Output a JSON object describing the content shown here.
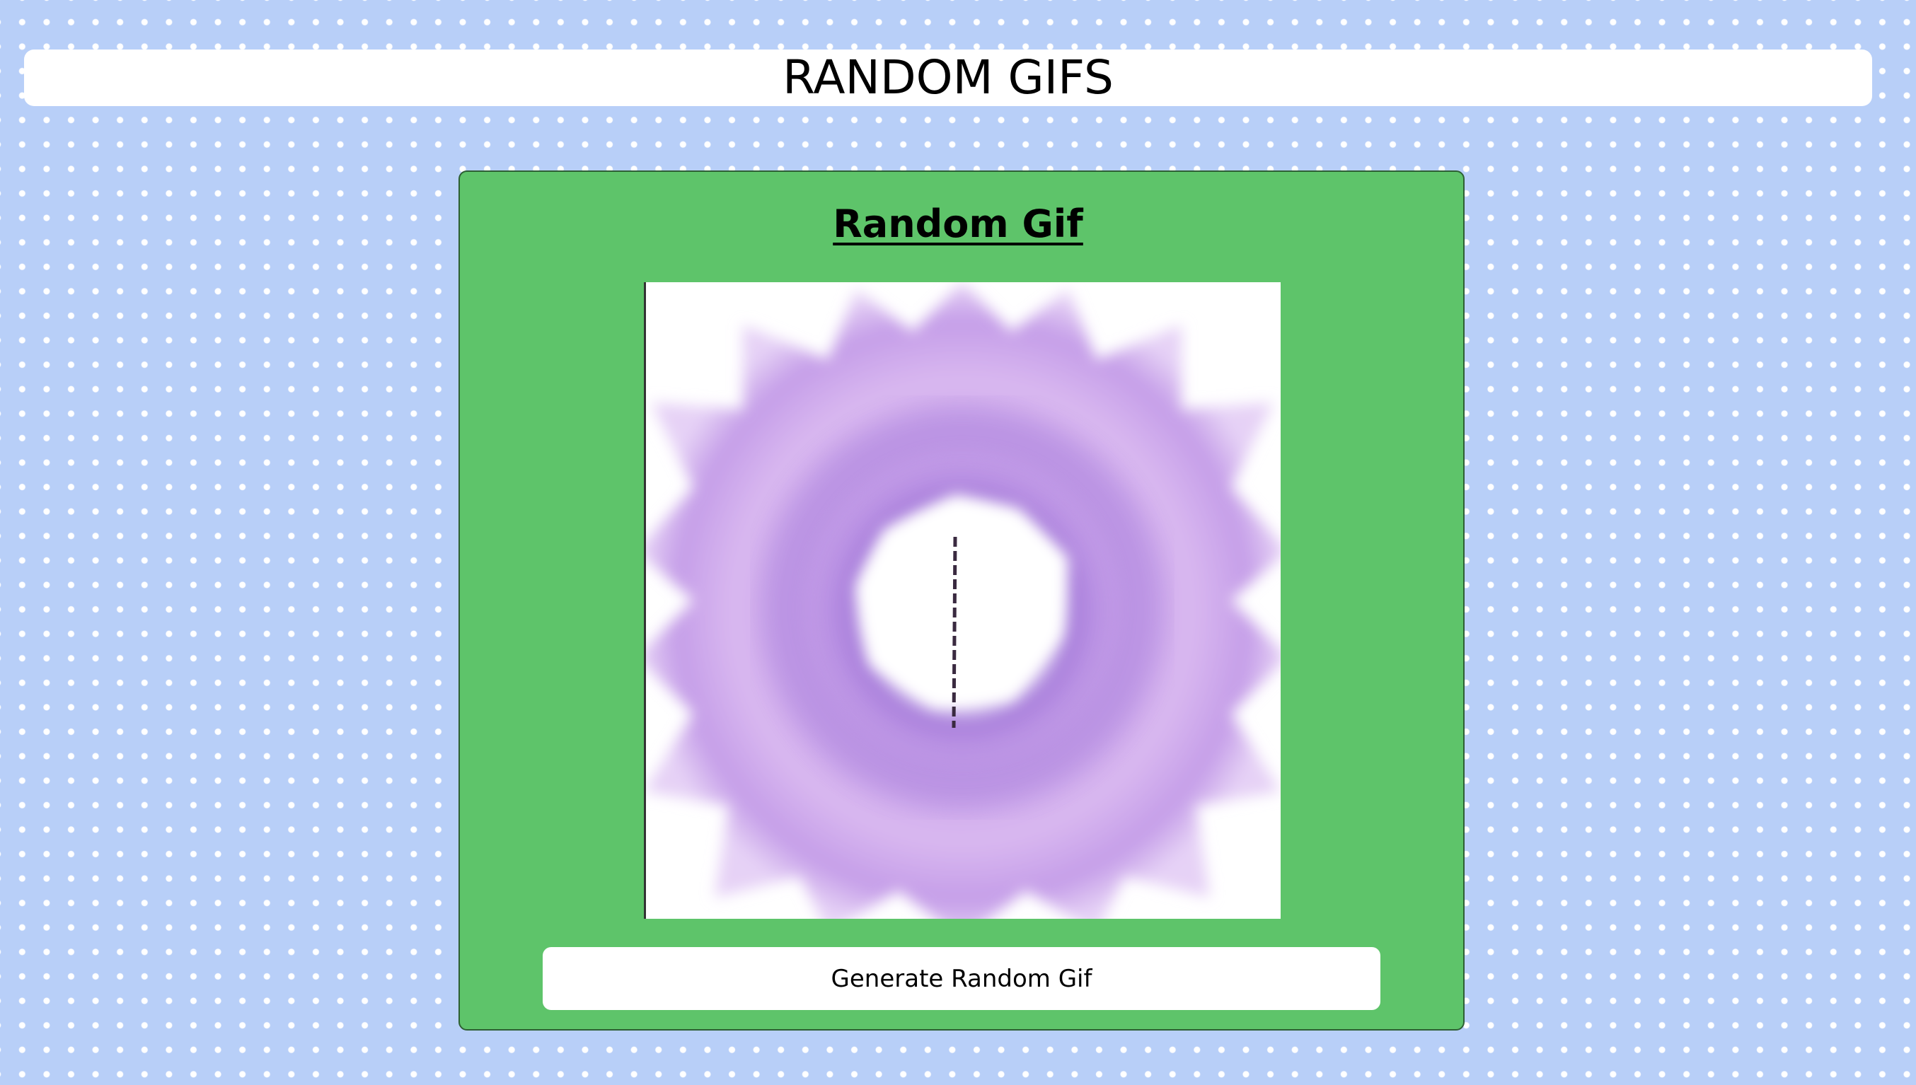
{
  "header": {
    "title": "RANDOM GIFS"
  },
  "card": {
    "title": "Random Gif",
    "gif": {
      "alt": "Random Gif",
      "description_icon": "purple-flower-gif-image"
    },
    "button_label": "Generate Random Gif"
  },
  "colors": {
    "page_background": "#b8cff8",
    "dot": "#ffffff",
    "card_background": "#5ec46a",
    "card_border": "#2e5f34",
    "gif_purple": "#c9a3ea",
    "gif_purple_dark": "#9f72d6",
    "button_background": "#ffffff"
  }
}
